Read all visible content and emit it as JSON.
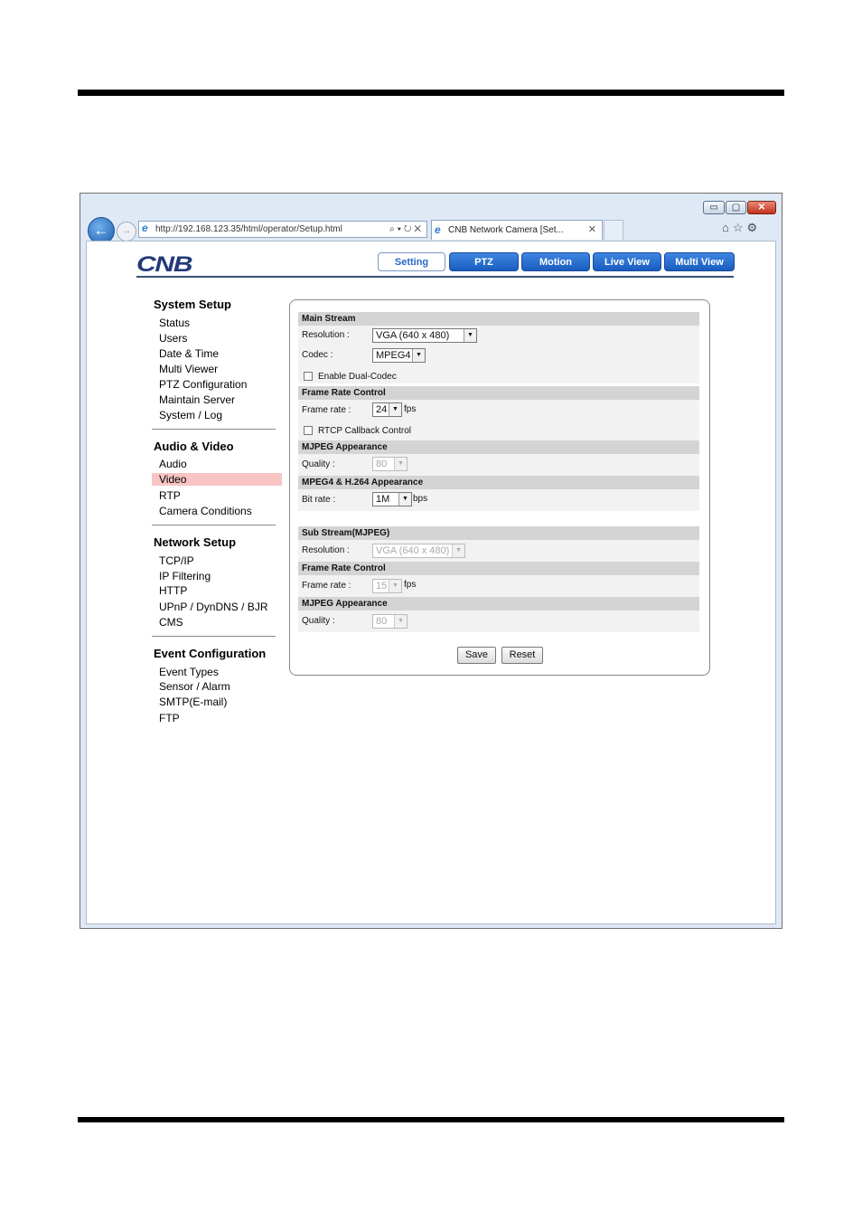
{
  "browser": {
    "address": "http://192.168.123.35/html/operator/Setup.html",
    "tab_title": "CNB Network Camera [Set...",
    "min_label": "▭",
    "max_label": "▢",
    "close_label": "✕"
  },
  "app": {
    "logo": "CNB",
    "nav": [
      "Setting",
      "PTZ",
      "Motion",
      "Live View",
      "Multi View"
    ]
  },
  "sidebar": {
    "system_setup": {
      "title": "System Setup",
      "items": [
        "Status",
        "Users",
        "Date & Time",
        "Multi Viewer",
        "PTZ Configuration",
        "Maintain Server",
        "System / Log"
      ]
    },
    "audio_video": {
      "title": "Audio & Video",
      "items": [
        "Audio",
        "Video",
        "RTP",
        "Camera Conditions"
      ],
      "active": "Video"
    },
    "network_setup": {
      "title": "Network Setup",
      "items": [
        "TCP/IP",
        "IP Filtering",
        "HTTP",
        "UPnP / DynDNS / BJR",
        "CMS"
      ]
    },
    "event_configuration": {
      "title": "Event Configuration",
      "items": [
        "Event Types",
        "Sensor / Alarm",
        "SMTP(E-mail)",
        "FTP"
      ]
    }
  },
  "main_stream": {
    "header": "Main Stream",
    "resolution_label": "Resolution :",
    "resolution_value": "VGA (640 x 480)",
    "codec_label": "Codec :",
    "codec_value": "MPEG4",
    "dual_codec_label": "Enable Dual-Codec",
    "frame_rate_header": "Frame Rate Control",
    "frame_rate_label": "Frame rate :",
    "frame_rate_value": "24",
    "frame_rate_unit": "fps",
    "rtcp_label": "RTCP Callback Control",
    "mjpeg_header": "MJPEG Appearance",
    "quality_label": "Quality :",
    "quality_value": "80",
    "mpeg_header": "MPEG4 & H.264 Appearance",
    "bitrate_label": "Bit rate :",
    "bitrate_value": "1M",
    "bitrate_unit": "bps"
  },
  "sub_stream": {
    "header": "Sub Stream(MJPEG)",
    "resolution_label": "Resolution :",
    "resolution_value": "VGA (640 x 480)",
    "frame_rate_header": "Frame Rate Control",
    "frame_rate_label": "Frame rate :",
    "frame_rate_value": "15",
    "frame_rate_unit": "fps",
    "mjpeg_header": "MJPEG Appearance",
    "quality_label": "Quality :",
    "quality_value": "80"
  },
  "actions": {
    "save": "Save",
    "reset": "Reset"
  }
}
